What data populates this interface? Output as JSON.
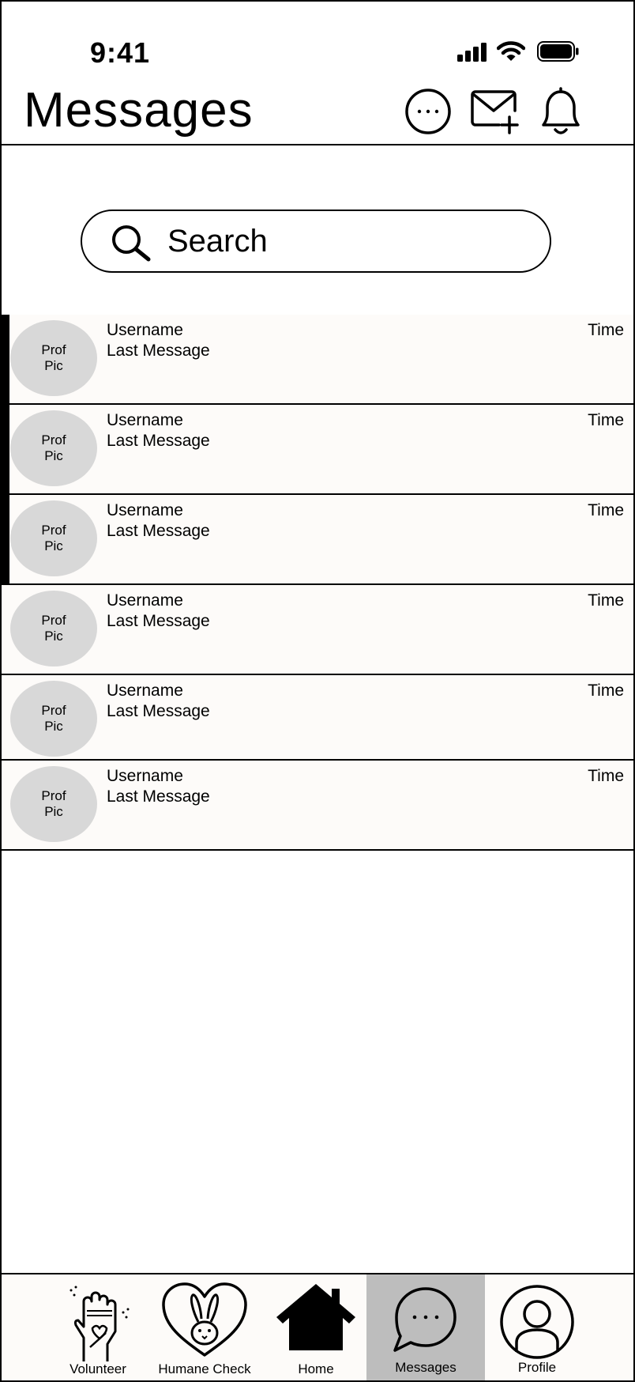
{
  "status_bar": {
    "time": "9:41"
  },
  "header": {
    "title": "Messages"
  },
  "search": {
    "placeholder": "Search"
  },
  "messages": [
    {
      "avatar": "Prof\nPic",
      "username": "Username",
      "last_message": "Last Message",
      "time": "Time",
      "unread": true
    },
    {
      "avatar": "Prof\nPic",
      "username": "Username",
      "last_message": "Last Message",
      "time": "Time",
      "unread": true
    },
    {
      "avatar": "Prof\nPic",
      "username": "Username",
      "last_message": "Last Message",
      "time": "Time",
      "unread": true
    },
    {
      "avatar": "Prof\nPic",
      "username": "Username",
      "last_message": "Last Message",
      "time": "Time",
      "unread": false
    },
    {
      "avatar": "Prof\nPic",
      "username": "Username",
      "last_message": "Last Message",
      "time": "Time",
      "unread": false
    },
    {
      "avatar": "Prof\nPic",
      "username": "Username",
      "last_message": "Last Message",
      "time": "Time",
      "unread": false
    }
  ],
  "nav": {
    "volunteer": "Volunteer",
    "humane_check": "Humane Check",
    "home": "Home",
    "messages": "Messages",
    "profile": "Profile",
    "active": "messages"
  },
  "icons": {
    "header": [
      "more-options-icon",
      "new-message-icon",
      "notification-bell-icon"
    ],
    "nav": [
      "volunteer-hand-icon",
      "humane-check-rabbit-icon",
      "home-icon",
      "messages-bubble-icon",
      "profile-icon"
    ]
  },
  "colors": {
    "row_background": "#fdfbf9",
    "avatar": "#d8d8d8",
    "active_tab": "#bdbdbd"
  }
}
